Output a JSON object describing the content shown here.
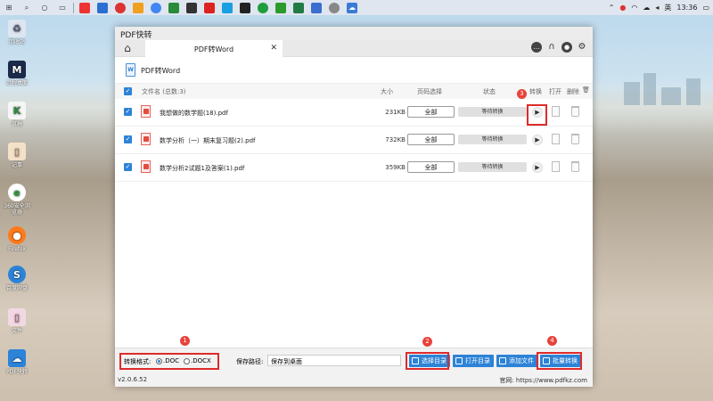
{
  "taskbar": {
    "tray": {
      "lang": "英",
      "time": "13:36"
    }
  },
  "desktop": {
    "icons": [
      {
        "label": "回收站",
        "icon": "recycle-bin-icon"
      },
      {
        "label": "远程桌面",
        "icon": "app-icon"
      },
      {
        "label": "草稿",
        "icon": "app-icon"
      },
      {
        "label": "记事",
        "icon": "app-icon"
      },
      {
        "label": "360安全浏览器",
        "icon": "browser-icon"
      },
      {
        "label": "Firefox",
        "icon": "firefox-icon"
      },
      {
        "label": "百度网盘",
        "icon": "cloud-icon"
      },
      {
        "label": "文件",
        "icon": "app-icon"
      },
      {
        "label": "PDF快转",
        "icon": "cloud-icon"
      }
    ]
  },
  "window": {
    "title": "PDF快转",
    "tab_label": "PDF转Word",
    "page_title": "PDF转Word",
    "table": {
      "headers": {
        "filename": "文件名 (总数:3)",
        "size": "大小",
        "page_select": "页码选择",
        "status": "状态",
        "convert": "转换",
        "open": "打开",
        "delete": "删除"
      },
      "rows": [
        {
          "name": "我想做的数学题(18).pdf",
          "size": "231KB",
          "pages": "全部",
          "status": "等待转换"
        },
        {
          "name": "数学分析（一）期末复习题(2).pdf",
          "size": "732KB",
          "pages": "全部",
          "status": "等待转换"
        },
        {
          "name": "数学分析2试题1及答案(1).pdf",
          "size": "359KB",
          "pages": "全部",
          "status": "等待转换"
        }
      ]
    },
    "footer": {
      "format_label": "转换格式:",
      "format_options": [
        ".DOC",
        ".DOCX"
      ],
      "save_label": "保存路径:",
      "save_value": "保存到桌面",
      "buttons": {
        "choose_dir": "选择目录",
        "open_dir": "打开目录",
        "add_file": "添加文件",
        "batch_convert": "批量转换"
      },
      "version": "v2.0.6.52",
      "website": "官网: https://www.pdfkz.com"
    },
    "annotations": [
      "1",
      "2",
      "3",
      "4"
    ]
  },
  "colors": {
    "accent": "#2d83d7",
    "highlight": "#e02a2a"
  }
}
